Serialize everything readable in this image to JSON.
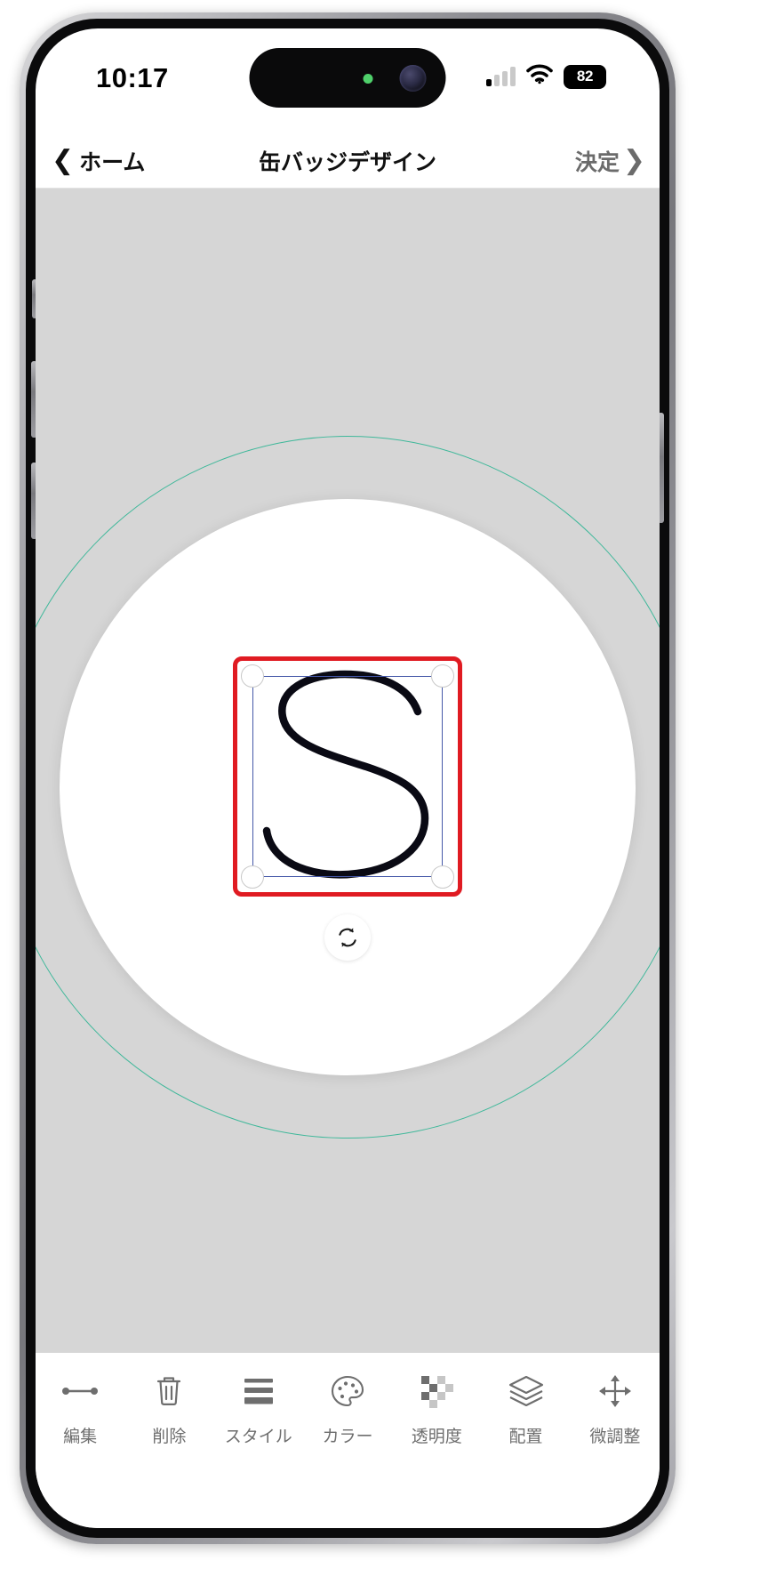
{
  "status_bar": {
    "time": "10:17",
    "battery_level": "82",
    "signal_icon": "cellular-signal-icon",
    "wifi_icon": "wifi-icon",
    "battery_icon": "battery-icon"
  },
  "nav_bar": {
    "back_label": "ホーム",
    "back_icon": "chevron-left-icon",
    "title": "缶バッジデザイン",
    "done_label": "決定",
    "done_icon": "chevron-right-icon"
  },
  "canvas": {
    "background_color": "#d6d6d6",
    "badge_face_color": "#ffffff",
    "guide_circle_color": "#3fb89a",
    "selection": {
      "outer_border_color": "#e01b22",
      "inner_border_color": "#4558a8",
      "handle_icon": "resize-handle",
      "rotate_icon": "rotate-icon",
      "artwork": "letter-s-stroke"
    }
  },
  "toolbar": {
    "items": [
      {
        "label": "編集",
        "icon": "line-edit-icon"
      },
      {
        "label": "削除",
        "icon": "trash-icon"
      },
      {
        "label": "スタイル",
        "icon": "style-lines-icon"
      },
      {
        "label": "カラー",
        "icon": "palette-icon"
      },
      {
        "label": "透明度",
        "icon": "transparency-checker-icon"
      },
      {
        "label": "配置",
        "icon": "layers-icon"
      },
      {
        "label": "微調整",
        "icon": "move-arrows-icon"
      }
    ]
  }
}
